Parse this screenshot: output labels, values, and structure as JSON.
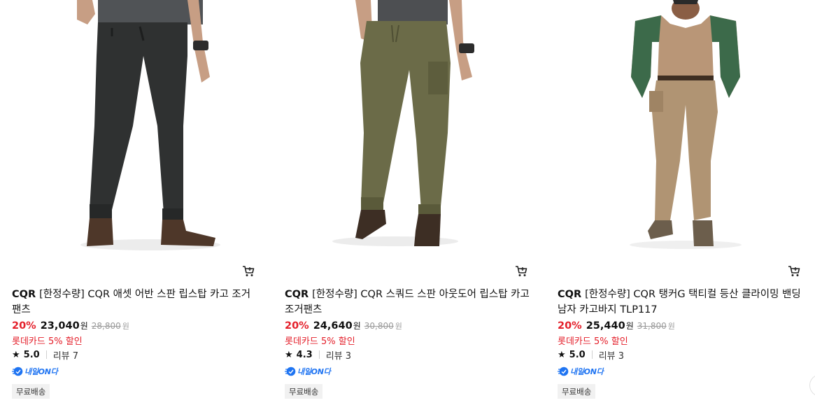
{
  "products": [
    {
      "brand": "CQR",
      "name": "[한정수량] CQR 애셋 어반 스판 립스탑 카고 조거 팬츠",
      "discount": "20%",
      "price": "23,040",
      "currency": "원",
      "original_price": "28,800",
      "original_currency": "원",
      "card_discount": "롯데카드 5% 할인",
      "rating": "5.0",
      "reviews": "리뷰 7",
      "delivery_badge": "내일ON다",
      "shipping_tag": "무료배송",
      "image": {
        "pants_color": "#2f3131",
        "shirt_color": "#505356",
        "shoe_color": "#4e3729",
        "arm_color": "#c79e84"
      }
    },
    {
      "brand": "CQR",
      "name": "[한정수량] CQR 스쿼드 스판 아웃도어 립스탑 카고 조거팬츠",
      "discount": "20%",
      "price": "24,640",
      "currency": "원",
      "original_price": "30,800",
      "original_currency": "원",
      "card_discount": "롯데카드 5% 할인",
      "rating": "4.3",
      "reviews": "리뷰 3",
      "delivery_badge": "내일ON다",
      "shipping_tag": "무료배송",
      "image": {
        "pants_color": "#6b6b48",
        "shirt_color": "#4d4f52",
        "shoe_color": "#3d2e24",
        "arm_color": "#c79e84"
      }
    },
    {
      "brand": "CQR",
      "name": "[한정수량] CQR 탱커G 택티컬 등산 클라이밍 밴딩 남자 카고바지 TLP117",
      "discount": "20%",
      "price": "25,440",
      "currency": "원",
      "original_price": "31,800",
      "original_currency": "원",
      "card_discount": "롯데카드 5% 할인",
      "rating": "5.0",
      "reviews": "리뷰 3",
      "delivery_badge": "내일ON다",
      "shipping_tag": "무료배송",
      "image": {
        "pants_color": "#b09473",
        "shirt_color": "#b99677",
        "sleeve_color": "#3c6a4a",
        "shoe_color": "#6c5e4c",
        "arm_color": "#8a5e45"
      }
    }
  ],
  "colors": {
    "accent_red": "#e4202b",
    "badge_blue": "#1f74f2",
    "muted_gray": "#9a9a9a",
    "tag_bg": "#f1f1f1"
  },
  "icons": {
    "cart": "cart-icon",
    "star": "star-icon",
    "delivery": "delivery-icon"
  }
}
